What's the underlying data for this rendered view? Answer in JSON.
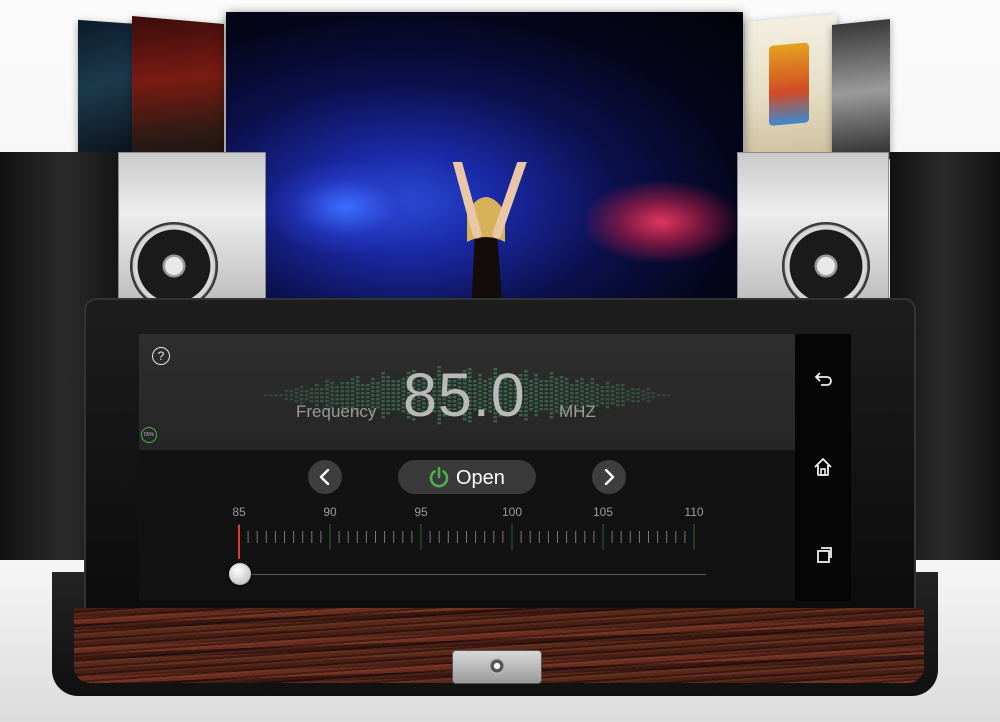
{
  "radio": {
    "frequency_label": "Frequency",
    "frequency_value": "85.0",
    "unit": "MHZ",
    "battery": "55%",
    "open_label": "Open",
    "scale": [
      "85",
      "90",
      "95",
      "100",
      "105",
      "110"
    ],
    "tuned_fraction": 0.0
  },
  "nav": {
    "back": "back-icon",
    "home": "home-icon",
    "recent": "recent-apps-icon"
  },
  "colors": {
    "accent": "#4caf50",
    "needle": "#e53935",
    "wood": "#5a2719"
  }
}
